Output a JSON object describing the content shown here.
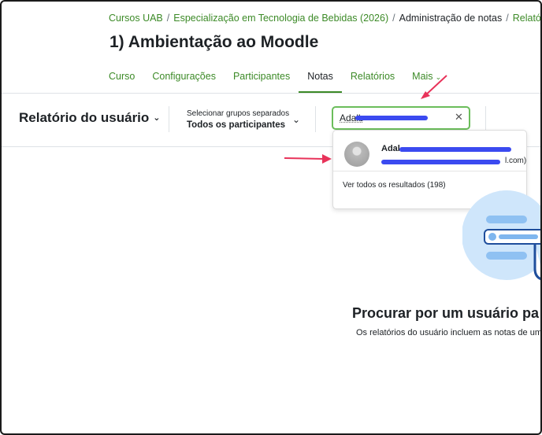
{
  "breadcrumb": {
    "items": [
      "Cursos UAB",
      "Especialização em Tecnologia de Bebidas (2026)",
      "Administração de notas",
      "Relatório do usuário"
    ],
    "separator": "/"
  },
  "page": {
    "title": "1) Ambientação ao Moodle"
  },
  "secondary_nav": {
    "tabs": [
      "Curso",
      "Configurações",
      "Participantes",
      "Notas",
      "Relatórios",
      "Mais"
    ],
    "active": "Notas",
    "more_caret": "⌄"
  },
  "toolbar": {
    "report_selector": "Relatório do usuário",
    "report_caret": "⌄",
    "groups_label": "Selecionar grupos separados",
    "groups_value": "Todos os participantes",
    "groups_caret": "⌄",
    "search_value": "Adalb",
    "clear_glyph": "✕"
  },
  "search_results": {
    "user_name_visible": "Adal",
    "user_email_visible": "l.com)",
    "view_all": "Ver todos os resultados (198)"
  },
  "empty_state": {
    "title": "Procurar por um usuário pa",
    "description": "Os relatórios do usuário incluem as notas de um u"
  },
  "colors": {
    "accent_green": "#3c8a27",
    "focus_border": "#6bbd5b",
    "redaction": "#3b4af0",
    "annotation_arrow": "#e8335a",
    "illustration_blue": "#cfe6fb"
  }
}
